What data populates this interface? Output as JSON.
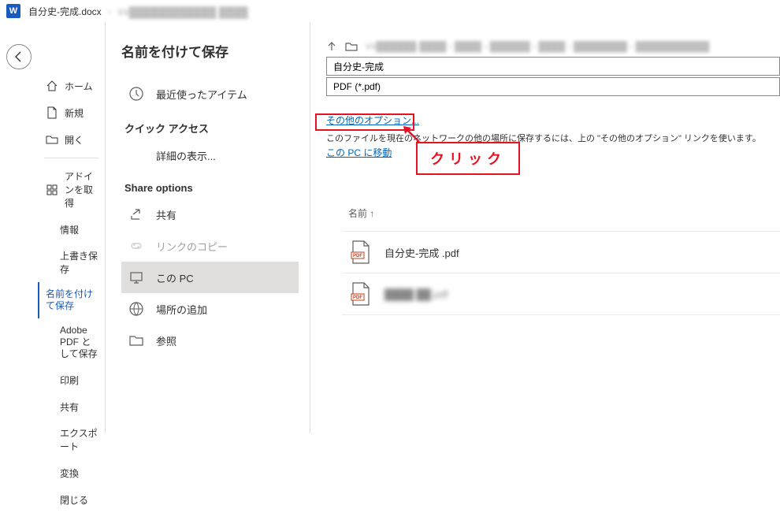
{
  "title_bar": {
    "doc_name": "自分史-完成.docx",
    "path_prefix": "・ ¥¥"
  },
  "nav": {
    "home": "ホーム",
    "new": "新規",
    "open": "開く",
    "addins": "アドインを取得",
    "info": "情報",
    "save": "上書き保存",
    "save_as": "名前を付けて保存",
    "adobe_pdf": "Adobe PDF として保存",
    "print": "印刷",
    "share": "共有",
    "export": "エクスポート",
    "transform": "変換",
    "close": "閉じる"
  },
  "mid": {
    "heading": "名前を付けて保存",
    "recent": "最近使ったアイテム",
    "quick_access": "クイック アクセス",
    "show_details": "詳細の表示...",
    "share_options": "Share options",
    "share": "共有",
    "copy_link": "リンクのコピー",
    "this_pc": "この PC",
    "add_place": "場所の追加",
    "browse": "参照"
  },
  "right": {
    "path_prefix": "¥¥",
    "filename": "自分史-完成",
    "filetype": "PDF (*.pdf)",
    "more_options": "その他のオプション...",
    "desc": "このファイルを現在のネットワークの他の場所に保存するには、上の \"その他のオプション\" リンクを使います。",
    "move_to_pc": "この PC に移動",
    "callout": "クリック",
    "list_header": "名前 ↑",
    "files": [
      {
        "name": "自分史-完成 .pdf",
        "blur": false
      },
      {
        "name": "████ ██.pdf",
        "blur": true
      }
    ]
  }
}
